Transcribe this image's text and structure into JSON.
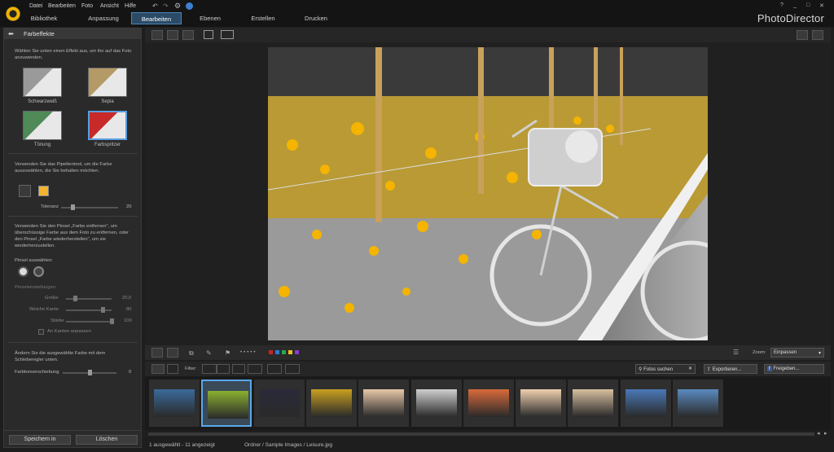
{
  "menu": [
    "Datei",
    "Bearbeiten",
    "Foto",
    "Ansicht",
    "Hilfe"
  ],
  "tabs": [
    {
      "label": "Bibliothek",
      "active": false
    },
    {
      "label": "Anpassung",
      "active": false
    },
    {
      "label": "Bearbeiten",
      "active": true
    },
    {
      "label": "Ebenen",
      "active": false
    },
    {
      "label": "Erstellen",
      "active": false
    },
    {
      "label": "Drucken",
      "active": false
    }
  ],
  "brand": "PhotoDirector",
  "window_controls": [
    "?",
    "_",
    "□",
    "✕"
  ],
  "panel": {
    "title": "Farbeffekte",
    "intro": "Wählen Sie unten einen Effekt aus, um ihn auf das Foto anzuwenden.",
    "effects": [
      {
        "label": "Schwarzweiß",
        "color": "#9a9a9a",
        "selected": false
      },
      {
        "label": "Sepia",
        "color": "#b49a66",
        "selected": false
      },
      {
        "label": "Tönung",
        "color": "#4f8a58",
        "selected": false
      },
      {
        "label": "Farbspritzer",
        "color": "#c82a2a",
        "selected": true
      }
    ],
    "pipette_text": "Verwenden Sie das Pipettentool, um die Farbe auszuwählen, die Sie behalten möchten.",
    "swatch_color": "#f1b52f",
    "tolerance_label": "Toleranz",
    "tolerance_value": "20",
    "tolerance_fraction": 0.2,
    "brush_text": "Verwenden Sie den Pinsel „Farbe entfernen\", um überschüssige Farbe aus dem Foto zu entfernen, oder den Pinsel „Farbe wiederherstellen\", um sie wiederherzustellen.",
    "brush_select_label": "Pinsel auswählen:",
    "brush_settings_label": "Pinseleinstellungen:",
    "brush_settings": [
      {
        "label": "Größe",
        "value": "20,0",
        "fraction": 0.2
      },
      {
        "label": "Weiche Kante",
        "value": "80",
        "fraction": 0.8
      },
      {
        "label": "Stärke",
        "value": "100",
        "fraction": 1.0
      }
    ],
    "edge_checkbox_label": "An Kanten anpassen",
    "shift_text": "Ändern Sie die ausgewählte Farbe mit dem Schieberegler unten.",
    "shift_label": "Farbtonverschiebung",
    "shift_value": "0",
    "shift_fraction": 0.5,
    "save_button": "Speichern in",
    "delete_button": "Löschen"
  },
  "filter": {
    "filter_label": "Filter:",
    "search_placeholder": "Fotos suchen",
    "export_label": "Exportieren...",
    "share_label": "Freigeben..."
  },
  "zoom": {
    "label": "Zoom:",
    "value": "Einpassen"
  },
  "color_tags": [
    "#cc2222",
    "#2a7bd6",
    "#2aa84a",
    "#e8c21a",
    "#8a3ad6"
  ],
  "filmstrip_colors": [
    "#3a6a9a",
    "#8ab030",
    "#2a2a3a",
    "#c9a020",
    "#e8c8a8",
    "#cfcfcf",
    "#d86a3a",
    "#f0d0b0",
    "#d8c0a0",
    "#4a78b8",
    "#5a8ac0"
  ],
  "status": {
    "count": "1 ausgewählt - 11 angezeigt",
    "path": "Ordner / Sample Images / Leisure.jpg"
  }
}
